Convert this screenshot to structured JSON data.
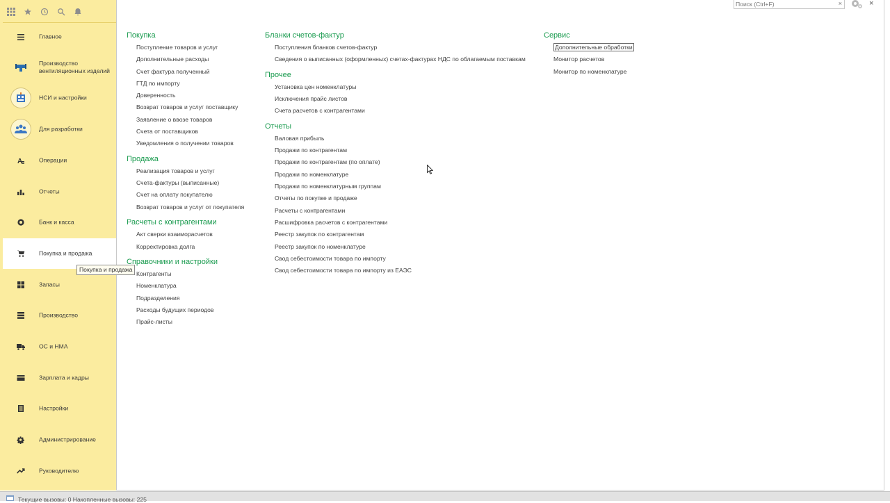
{
  "colors": {
    "sidebar_bg": "#fbec9f",
    "group_title": "#1a9b4f",
    "link_text": "#404040"
  },
  "topbar": {
    "icons": [
      "apps-grid-icon",
      "star-icon",
      "history-icon",
      "search-icon",
      "bell-icon"
    ]
  },
  "sidebar": {
    "items": [
      {
        "label": "Главное",
        "icon": "menu-lines-icon"
      },
      {
        "label": "Производство вентиляционных изделий",
        "icon": "ventilation-icon"
      },
      {
        "label": "НСИ и настройки",
        "icon": "reference-data-icon"
      },
      {
        "label": "Для разработки",
        "icon": "team-icon"
      },
      {
        "label": "Операции",
        "icon": "operations-icon"
      },
      {
        "label": "Отчеты",
        "icon": "bar-chart-icon"
      },
      {
        "label": "Банк и касса",
        "icon": "coin-icon"
      },
      {
        "label": "Покупка и продажа",
        "icon": "cart-icon"
      },
      {
        "label": "Запасы",
        "icon": "boxes-icon"
      },
      {
        "label": "Производство",
        "icon": "factory-icon"
      },
      {
        "label": "ОС и НМА",
        "icon": "truck-icon"
      },
      {
        "label": "Зарплата и кадры",
        "icon": "card-icon"
      },
      {
        "label": "Настройки",
        "icon": "settings-list-icon"
      },
      {
        "label": "Администрирование",
        "icon": "gear-icon"
      },
      {
        "label": "Руководителю",
        "icon": "trend-icon"
      }
    ],
    "active_index": 7,
    "tooltip": "Покупка и продажа"
  },
  "search": {
    "placeholder": "Поиск (Ctrl+F)",
    "clear": "×"
  },
  "window": {
    "close": "×"
  },
  "columns": [
    {
      "groups": [
        {
          "title": "Покупка",
          "links": [
            "Поступление товаров и услуг",
            "Дополнительные расходы",
            "Счет фактура полученный",
            "ГТД по импорту",
            "Доверенность",
            "Возврат товаров и услуг поставщику",
            "Заявление о ввозе товаров",
            "Счета от поставщиков",
            "Уведомления о получении товаров"
          ]
        },
        {
          "title": "Продажа",
          "links": [
            "Реализация товаров и услуг",
            "Счета-фактуры (выписанные)",
            "Счет на оплату покупателю",
            "Возврат товаров и услуг от покупателя"
          ]
        },
        {
          "title": "Расчеты с контрагентами",
          "links": [
            "Акт сверки взаиморасчетов",
            "Корректировка долга"
          ]
        },
        {
          "title": "Справочники и настройки",
          "links": [
            "Контрагенты",
            "Номенклатура",
            "Подразделения",
            "Расходы будущих периодов",
            "Прайс-листы"
          ]
        }
      ]
    },
    {
      "groups": [
        {
          "title": "Бланки счетов-фактур",
          "links": [
            "Поступления бланков счетов-фактур",
            "Сведения о выписанных (оформленных) счетах-фактурах НДС по облагаемым поставкам"
          ]
        },
        {
          "title": "Прочее",
          "links": [
            "Установка цен номенклатуры",
            "Исключения прайс листов",
            "Счета расчетов с контрагентами"
          ]
        },
        {
          "title": "Отчеты",
          "links": [
            "Валовая прибыль",
            "Продажи по контрагентам",
            "Продажи по контрагентам (по оплате)",
            "Продажи по номенклатуре",
            "Продажи по номенклатурным группам",
            "Отчеты по покупке и продаже",
            "Расчеты с контрагентами",
            "Расшифровка расчетов с контрагентами",
            "Реестр закупок по контрагентам",
            "Реестр закупок по номенклатуре",
            "Свод себестоимости товара по импорту",
            "Свод себестоимости товара по импорту из ЕАЭС"
          ]
        }
      ]
    },
    {
      "groups": [
        {
          "title": "Сервис",
          "links": [
            "Дополнительные обработки",
            "Монитор расчетов",
            "Монитор по номенклатуре"
          ],
          "focused_index": 0
        }
      ]
    }
  ],
  "statusbar": {
    "text": "Текущие вызовы: 0   Накопленные вызовы: 225"
  }
}
